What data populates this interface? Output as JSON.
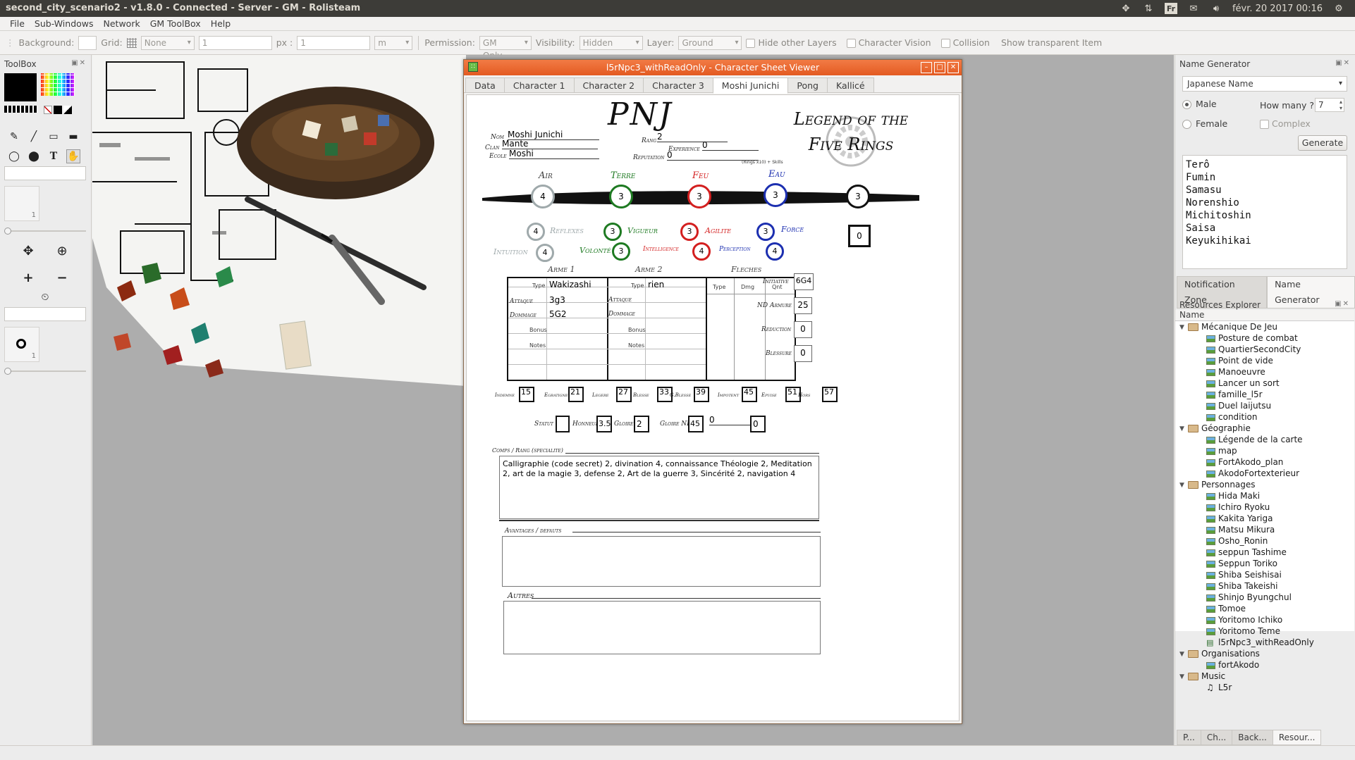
{
  "window": {
    "title": "second_city_scenario2 - v1.8.0 - Connected - Server - GM - Rolisteam"
  },
  "system": {
    "lang": "Fr",
    "datetime": "févr. 20 2017 00:16"
  },
  "menu": [
    "File",
    "Sub-Windows",
    "Network",
    "GM ToolBox",
    "Help"
  ],
  "toolbar": {
    "background_label": "Background:",
    "grid_label": "Grid:",
    "grid_value": "None",
    "size_value": "1",
    "px_label": "px :",
    "unit_count": "1",
    "unit_value": "m",
    "permission_label": "Permission:",
    "permission_value": "GM Only",
    "visibility_label": "Visibility:",
    "visibility_value": "Hidden",
    "layer_label": "Layer:",
    "layer_value": "Ground",
    "hide_other_layers": "Hide other Layers",
    "character_vision": "Character Vision",
    "collision": "Collision",
    "show_transparent": "Show transparent Item"
  },
  "toolbox": {
    "title": "ToolBox",
    "size1": "1",
    "size2": "1"
  },
  "sheet": {
    "window_title": "l5rNpc3_withReadOnly - Character Sheet Viewer",
    "tabs": [
      "Data",
      "Character 1",
      "Character 2",
      "Character 3",
      "Moshi  Junichi",
      "Pong",
      "Kallicé"
    ],
    "active_tab": 4,
    "title": "PNJ",
    "logo_lines": [
      "Legend of the",
      "Five Rings"
    ],
    "labels": {
      "nom": "Nom",
      "clan": "Clan",
      "ecole": "Ecole",
      "rang": "Rang",
      "experience": "Experience",
      "reputation": "Reputation",
      "rings_note": "(Rings x10) + Skills"
    },
    "values": {
      "nom": "Moshi Junichi",
      "clan": "Mante",
      "ecole": "Moshi",
      "rang": "2",
      "experience": "0",
      "reputation": "0"
    },
    "rings": {
      "air": {
        "label": "Air",
        "value": "4",
        "color": "#9fa9ab",
        "traits": [
          {
            "label": "Reflexes",
            "value": "4"
          },
          {
            "label": "Intuition",
            "value": "4"
          }
        ]
      },
      "terre": {
        "label": "Terre",
        "value": "3",
        "color": "#1e7a22",
        "traits": [
          {
            "label": "Vigueur",
            "value": "3"
          },
          {
            "label": "Volonté",
            "value": "3"
          }
        ]
      },
      "feu": {
        "label": "Feu",
        "value": "3",
        "color": "#d31f1f",
        "traits": [
          {
            "label": "Agilite",
            "value": "3"
          },
          {
            "label": "Intelligence",
            "value": "4"
          }
        ]
      },
      "eau": {
        "label": "Eau",
        "value": "3",
        "color": "#1c2fb0",
        "traits": [
          {
            "label": "Force",
            "value": "3"
          },
          {
            "label": "Perception",
            "value": "4"
          }
        ]
      },
      "void": {
        "value": "3",
        "points": "0",
        "color": "#111111"
      }
    },
    "weapons": {
      "arme1_label": "Arme 1",
      "arme2_label": "Arme 2",
      "fleches_label": "Fleches",
      "type_label": "Type",
      "attaque_label": "Attaque",
      "dommage_label": "Dommage",
      "bonus_label": "Bonus",
      "notes_label": "Notes",
      "dmg_label": "Dmg",
      "qnt_label": "Qnt",
      "arme1": {
        "type": "Wakizashi",
        "attaque": "3g3",
        "dommage": "5G2"
      },
      "arme2": {
        "type": "rien",
        "attaque": "",
        "dommage": ""
      }
    },
    "combat": {
      "initiative_label": "Initiative",
      "initiative": "6G4",
      "nd_armure_label": "ND Armure",
      "nd_armure": "25",
      "reduction_label": "Reduction",
      "reduction": "0",
      "blessure_label": "Blessure",
      "blessure": "0"
    },
    "wounds": [
      {
        "label": "Indemne",
        "value": "15"
      },
      {
        "label": "Egratigne",
        "value": "21"
      },
      {
        "label": "Legere",
        "value": "27"
      },
      {
        "label": "Blesse",
        "value": "33"
      },
      {
        "label": "G.Blesse",
        "value": "39"
      },
      {
        "label": "Impotent",
        "value": "45"
      },
      {
        "label": "Epuise",
        "value": "51"
      },
      {
        "label": "Hors",
        "value": "57"
      }
    ],
    "status": {
      "statut_label": "Statut",
      "statut": "",
      "honneur_label": "Honneur",
      "honneur": "3.5",
      "gloire_label": "Gloire",
      "gloire": "2",
      "gloire_nd_label": "Gloire ND",
      "gloire_nd": "45",
      "extra1": "0",
      "extra2": "0"
    },
    "skills_label": "Comps / Rang (specialite)",
    "skills": "Calligraphie (code secret) 2, divination 4, connaissance Théologie 2, Meditation 2, art de la magie 3, defense 2, Art de la guerre 3, Sincérité 2, navigation 4",
    "avantages_label": "Avantages / defauts",
    "autres_label": "Autres"
  },
  "name_generator": {
    "title": "Name Generator",
    "type": "Japanese Name",
    "male": "Male",
    "female": "Female",
    "how_many_label": "How many ?",
    "how_many": "7",
    "complex": "Complex",
    "generate": "Generate",
    "names": [
      "Terô",
      "Fumin",
      "Samasu",
      "Norenshio",
      "Michitoshin",
      "Saisa",
      "Keyukihikai"
    ],
    "tabs": [
      "Notification Zone",
      "Name Generator"
    ]
  },
  "resources": {
    "title": "Resources Explorer",
    "column": "Name",
    "tree": [
      {
        "name": "Mécanique De Jeu",
        "children": [
          "Posture de combat",
          "QuartierSecondCity",
          "Point de vide",
          "Manoeuvre",
          "Lancer un sort",
          "famille_l5r",
          "Duel Iaijutsu",
          "condition"
        ]
      },
      {
        "name": "Géographie",
        "children": [
          "Légende de la carte",
          "map",
          "FortAkodo_plan",
          "AkodoFortexterieur"
        ]
      },
      {
        "name": "Personnages",
        "children": [
          "Hida Maki",
          "Ichiro Ryoku",
          "Kakita Yariga",
          "Matsu Mikura",
          "Osho_Ronin",
          "seppun Tashime",
          "Seppun Toriko",
          "Shiba Seishisai",
          "Shiba Takeishi",
          "Shinjo Byungchul",
          "Tomoe",
          "Yoritomo Ichiko",
          "Yoritomo Teme",
          "l5rNpc3_withReadOnly"
        ]
      },
      {
        "name": "Organisations",
        "children": [
          "fortAkodo"
        ]
      },
      {
        "name": "Music",
        "children": [
          "L5r"
        ]
      }
    ],
    "bottom_tabs": [
      "P...",
      "Ch...",
      "Back...",
      "Resour..."
    ]
  }
}
